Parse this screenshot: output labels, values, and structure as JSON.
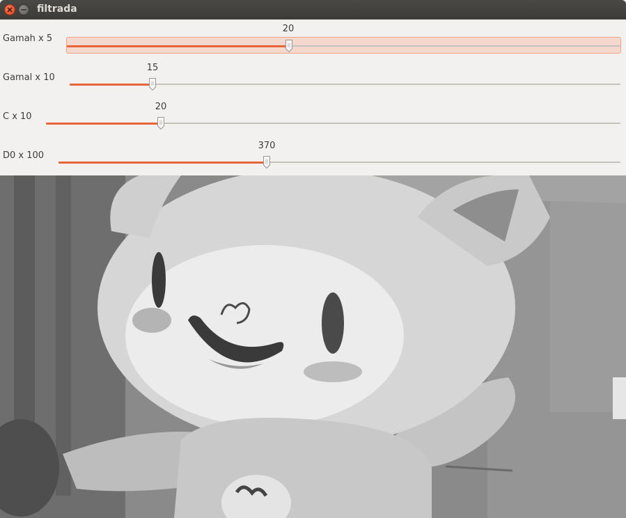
{
  "window": {
    "title": "filtrada",
    "close_icon": "close-icon",
    "minimize_icon": "minimize-icon"
  },
  "trackbars": [
    {
      "label": "Gamah x 5",
      "value": "20",
      "fraction": 0.4,
      "focused": true
    },
    {
      "label": "Gamal x 10",
      "value": "15",
      "fraction": 0.15,
      "focused": false
    },
    {
      "label": "C x 10",
      "value": "20",
      "fraction": 0.2,
      "focused": false
    },
    {
      "label": "D0 x 100",
      "value": "370",
      "fraction": 0.37,
      "focused": false
    }
  ],
  "colors": {
    "accent": "#e8653a",
    "titlebar": "#3c3b37",
    "background": "#f2f1f0"
  },
  "image": {
    "subject": "grayscale-filtered-photo"
  }
}
